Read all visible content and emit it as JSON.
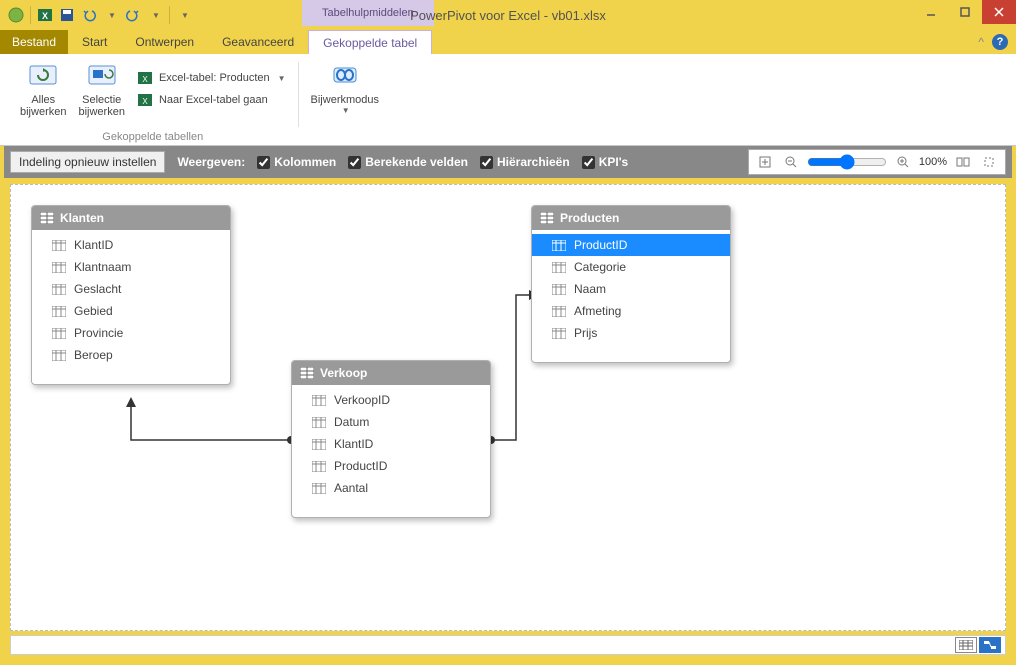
{
  "window": {
    "contextual_tab": "Tabelhulpmiddelen",
    "title": "PowerPivot voor Excel - vb01.xlsx"
  },
  "tabs": {
    "file": "Bestand",
    "start": "Start",
    "ontwerpen": "Ontwerpen",
    "geavanceerd": "Geavanceerd",
    "gekoppelde": "Gekoppelde tabel"
  },
  "ribbon": {
    "alles_bijwerken": "Alles\nbijwerken",
    "selectie_bijwerken": "Selectie\nbijwerken",
    "excel_tabel_label": "Excel-tabel: Producten",
    "naar_excel_tabel": "Naar Excel-tabel gaan",
    "bijwerkmodus": "Bijwerkmodus",
    "group_label": "Gekoppelde tabellen"
  },
  "toolbar": {
    "reset_layout": "Indeling opnieuw instellen",
    "weergeven": "Weergeven:",
    "kolommen": "Kolommen",
    "berekende_velden": "Berekende velden",
    "hierarchieen": "Hiërarchieën",
    "kpis": "KPI's",
    "zoom": "100%"
  },
  "entities": {
    "klanten": {
      "title": "Klanten",
      "fields": [
        "KlantID",
        "Klantnaam",
        "Geslacht",
        "Gebied",
        "Provincie",
        "Beroep"
      ]
    },
    "verkoop": {
      "title": "Verkoop",
      "fields": [
        "VerkoopID",
        "Datum",
        "KlantID",
        "ProductID",
        "Aantal"
      ]
    },
    "producten": {
      "title": "Producten",
      "fields": [
        "ProductID",
        "Categorie",
        "Naam",
        "Afmeting",
        "Prijs"
      ],
      "selected": "ProductID"
    }
  }
}
